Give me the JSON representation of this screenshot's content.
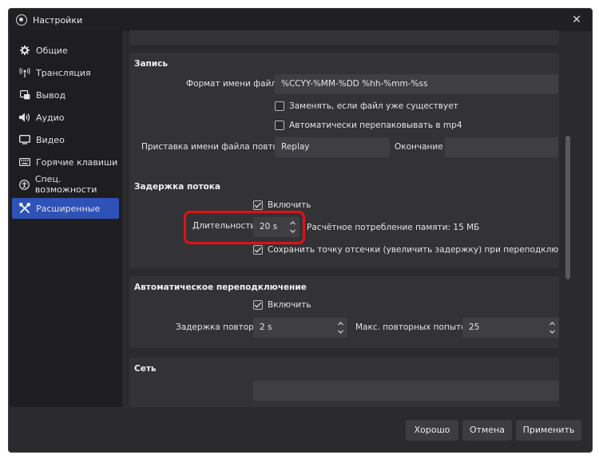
{
  "window": {
    "title": "Настройки"
  },
  "sidebar": {
    "items": [
      {
        "label": "Общие",
        "icon": "gear-icon"
      },
      {
        "label": "Трансляция",
        "icon": "broadcast-icon"
      },
      {
        "label": "Вывод",
        "icon": "output-icon"
      },
      {
        "label": "Аудио",
        "icon": "speaker-icon"
      },
      {
        "label": "Видео",
        "icon": "monitor-icon"
      },
      {
        "label": "Горячие клавиши",
        "icon": "keyboard-icon"
      },
      {
        "label": "Спец. возможности",
        "icon": "accessibility-icon"
      },
      {
        "label": "Расширенные",
        "icon": "wrench-icon"
      }
    ],
    "active_index": 7
  },
  "recording": {
    "title": "Запись",
    "filename_format_label": "Формат имени файла",
    "filename_format_value": "%CCYY-%MM-%DD %hh-%mm-%ss",
    "overwrite_label": "Заменять, если файл уже существует",
    "overwrite_checked": false,
    "remux_label": "Автоматически перепаковывать в mp4",
    "remux_checked": false,
    "replay_prefix_label": "Приставка имени файла повтора",
    "replay_prefix_value": "Replay",
    "suffix_label": "Окончание",
    "suffix_value": ""
  },
  "stream_delay": {
    "title": "Задержка потока",
    "enable_label": "Включить",
    "enable_checked": true,
    "duration_label": "Длительность",
    "duration_value": "20 s",
    "memory_text": "Расчётное потребление памяти: 15 МБ",
    "preserve_label": "Сохранить точку отсечки (увеличить задержку) при переподключении",
    "preserve_checked": true
  },
  "reconnect": {
    "title": "Автоматическое переподключение",
    "enable_label": "Включить",
    "enable_checked": true,
    "retry_delay_label": "Задержка повтора",
    "retry_delay_value": "2 s",
    "max_retries_label": "Макс. повторных попыток",
    "max_retries_value": "25"
  },
  "network": {
    "title": "Сеть"
  },
  "buttons": {
    "ok": "Хорошо",
    "cancel": "Отмена",
    "apply": "Применить"
  },
  "colors": {
    "accent": "#2f52b8",
    "highlight": "#e01212",
    "background": "#2b2b2e"
  }
}
